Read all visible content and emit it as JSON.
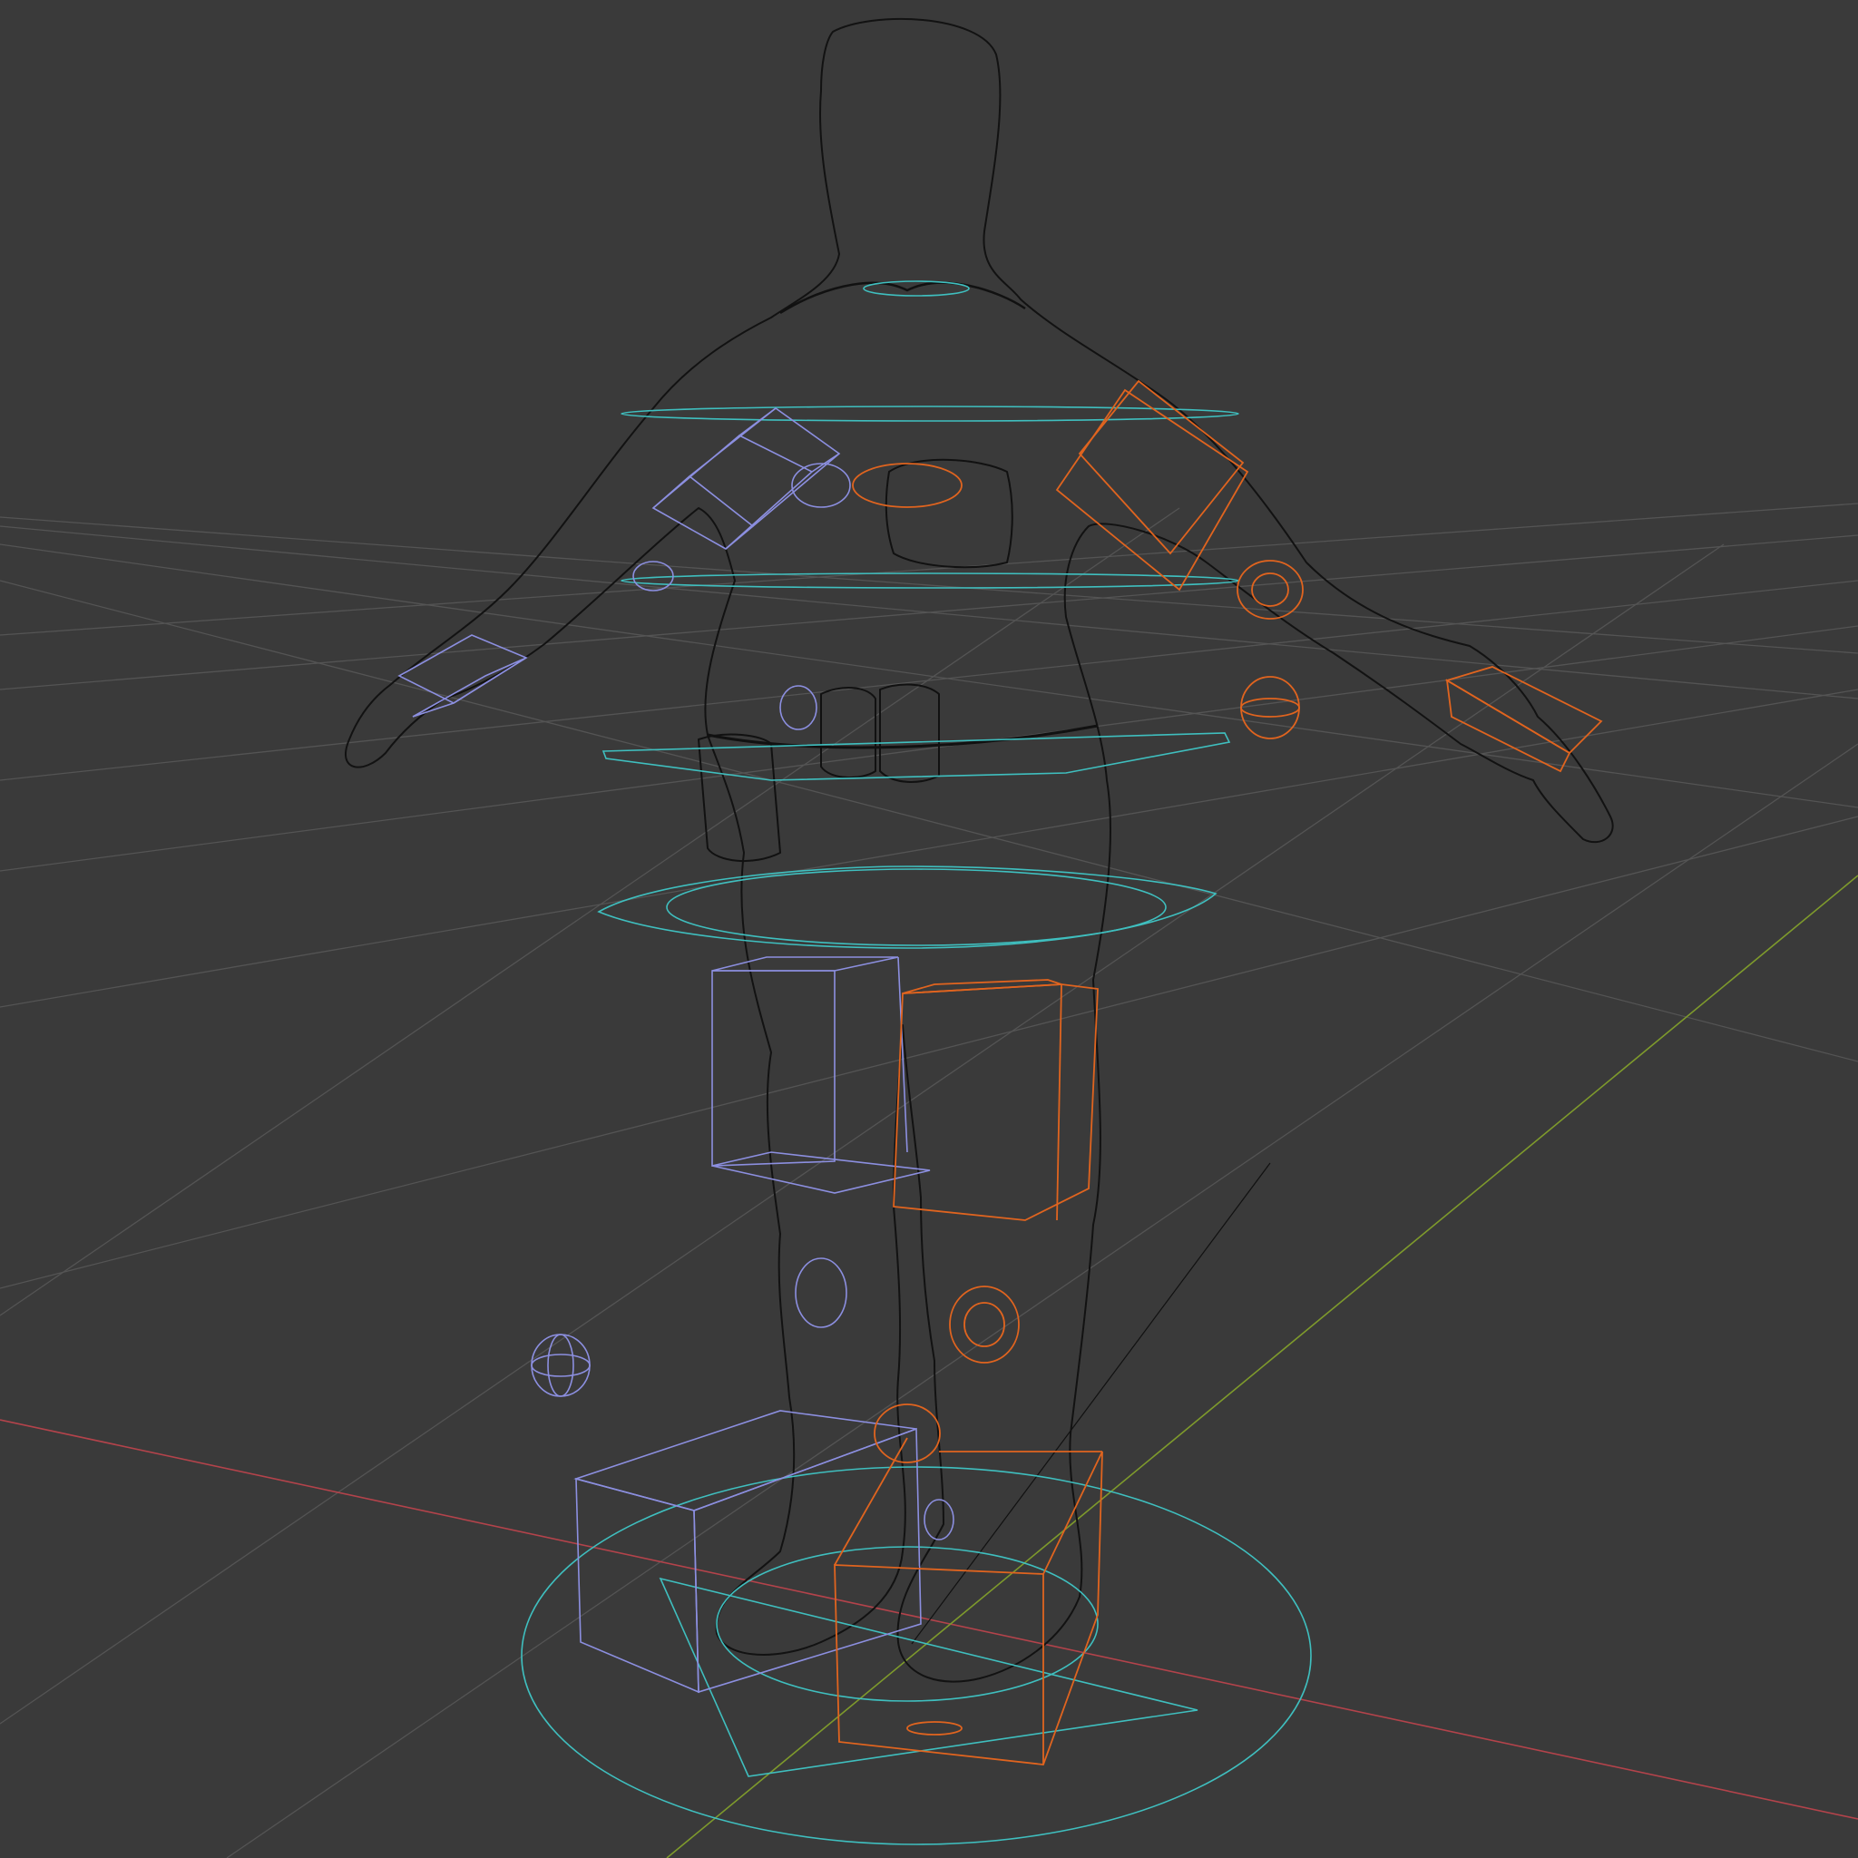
{
  "viewport": {
    "mode": "wireframe",
    "background_color": "#3a3a3a"
  },
  "colors": {
    "grid": "#545454",
    "x_axis": "#b3434b",
    "y_axis": "#7e9a2c",
    "mesh_wire": "#141414",
    "left_side_controls": "#8c8fe0",
    "right_side_controls": "#e0641f",
    "center_controls": "#3fbfbf"
  },
  "scene_objects": [
    {
      "name": "character-mesh",
      "type": "wireframe mesh"
    },
    {
      "name": "rig-controls-left",
      "color": "blue"
    },
    {
      "name": "rig-controls-right",
      "color": "orange"
    },
    {
      "name": "rig-controls-center",
      "color": "cyan"
    }
  ]
}
